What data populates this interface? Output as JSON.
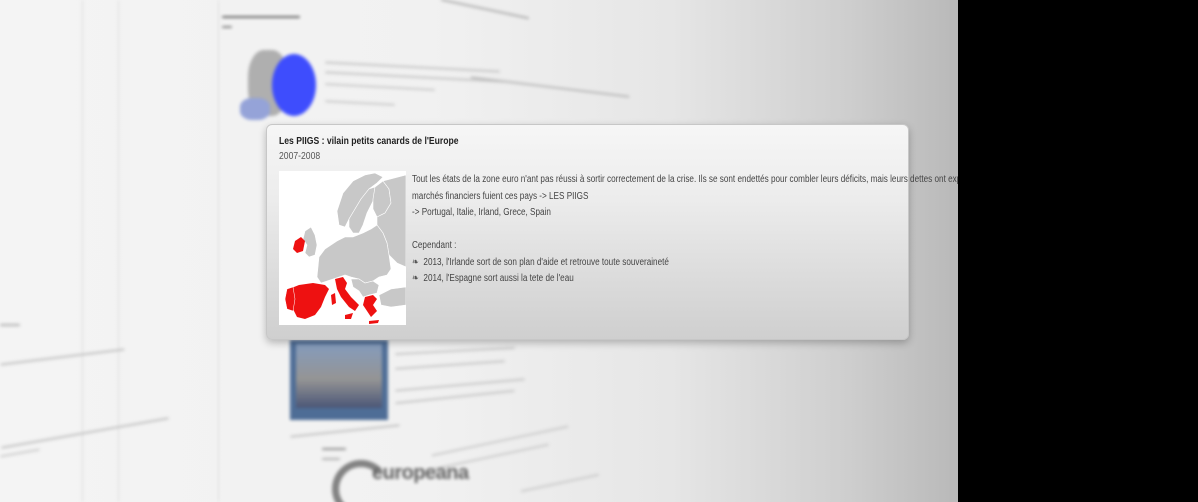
{
  "popup": {
    "title": "Les PIIGS : vilain petits canards de l'Europe",
    "date": "2007-2008",
    "lines": [
      "Tout les états de la zone euro n'ant pas réussi à sortir correctement de la crise. Ils se sont endettés pour combler leurs déficits, mais leurs dettes ont exploser. Les",
      "marchés financiers fuient ces pays -> LES PIIGS",
      "-> Portugal, Italie, Irland, Grece, Spain"
    ],
    "however_label": "Cependant :",
    "bullets": [
      "2013, l'Irlande sort de son plan d'aide et retrouve toute souveraineté",
      "2014, l'Espagne sort aussi la tete de l'eau"
    ],
    "bullet_glyph": "❧",
    "map": {
      "highlighted_countries": [
        "Portugal",
        "Italie",
        "Irlande",
        "Grèce",
        "Espagne"
      ],
      "highlight_color": "#ee1111",
      "country_color": "#c8c8c8",
      "sea_color": "#ffffff"
    }
  },
  "background": {
    "logo_text": "europeana"
  }
}
